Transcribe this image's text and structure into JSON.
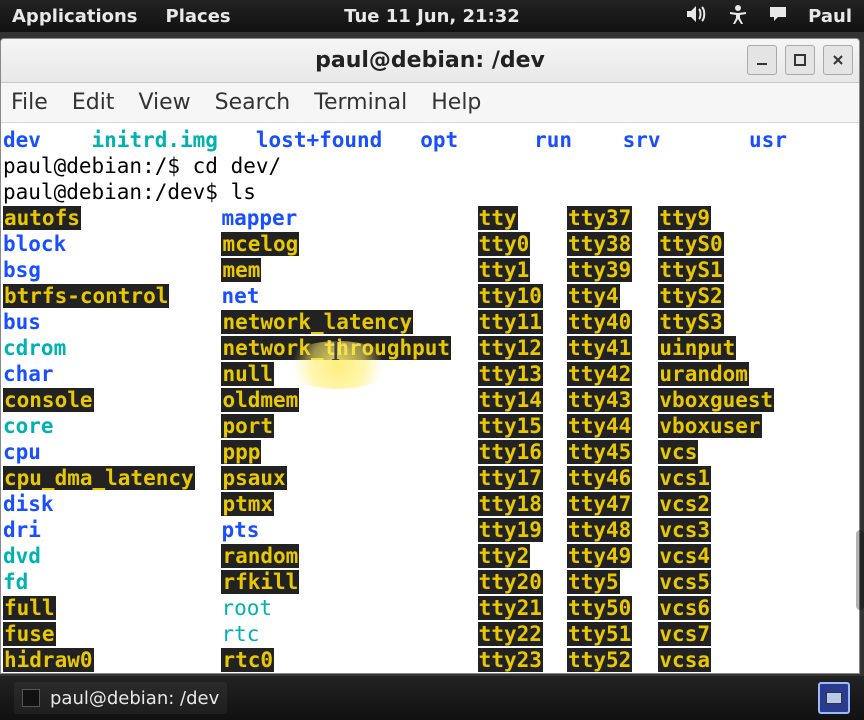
{
  "panel": {
    "applications": "Applications",
    "places": "Places",
    "clock": "Tue 11 Jun, 21:32",
    "user": "Paul"
  },
  "window": {
    "title": "paul@debian: /dev"
  },
  "menu": {
    "file": "File",
    "edit": "Edit",
    "view": "View",
    "search": "Search",
    "terminal": "Terminal",
    "help": "Help"
  },
  "topline": {
    "dev": "dev",
    "initrd": "initrd.img",
    "lostfound": "lost+found",
    "opt": "opt",
    "run": "run",
    "srv": "srv",
    "usr": "usr"
  },
  "prompt1": "paul@debian:/$ cd dev/",
  "prompt2": "paul@debian:/dev$ ls",
  "col1": [
    "autofs",
    "block",
    "bsg",
    "btrfs-control",
    "bus",
    "cdrom",
    "char",
    "console",
    "core",
    "cpu",
    "cpu_dma_latency",
    "disk",
    "dri",
    "dvd",
    "fd",
    "full",
    "fuse",
    "hidraw0"
  ],
  "col1_style": [
    "hl",
    "dir",
    "dir",
    "hl",
    "dir",
    "link-cyan",
    "dir",
    "hl",
    "link-cyan",
    "dir",
    "hl",
    "dir",
    "dir",
    "link-cyan",
    "link-cyan",
    "hl",
    "hl",
    "hl"
  ],
  "col2": [
    "mapper",
    "mcelog",
    "mem",
    "net",
    "network_latency",
    "network_throughput",
    "null",
    "oldmem",
    "port",
    "ppp",
    "psaux",
    "ptmx",
    "pts",
    "random",
    "rfkill",
    "root",
    "rtc",
    "rtc0"
  ],
  "col2_style": [
    "dir",
    "hl",
    "hl",
    "dir",
    "hl",
    "hl",
    "hl",
    "hl",
    "hl",
    "hl",
    "hl",
    "hl",
    "dir",
    "hl",
    "hl",
    "cyan-plain",
    "cyan-plain",
    "hl"
  ],
  "col3": [
    "tty",
    "tty0",
    "tty1",
    "tty10",
    "tty11",
    "tty12",
    "tty13",
    "tty14",
    "tty15",
    "tty16",
    "tty17",
    "tty18",
    "tty19",
    "tty2",
    "tty20",
    "tty21",
    "tty22",
    "tty23"
  ],
  "col4": [
    "tty37",
    "tty38",
    "tty39",
    "tty4",
    "tty40",
    "tty41",
    "tty42",
    "tty43",
    "tty44",
    "tty45",
    "tty46",
    "tty47",
    "tty48",
    "tty49",
    "tty5",
    "tty50",
    "tty51",
    "tty52"
  ],
  "col5": [
    "tty9",
    "ttyS0",
    "ttyS1",
    "ttyS2",
    "ttyS3",
    "uinput",
    "urandom",
    "vboxguest",
    "vboxuser",
    "vcs",
    "vcs1",
    "vcs2",
    "vcs3",
    "vcs4",
    "vcs5",
    "vcs6",
    "vcs7",
    "vcsa"
  ],
  "taskbar": {
    "title": "paul@debian: /dev"
  }
}
